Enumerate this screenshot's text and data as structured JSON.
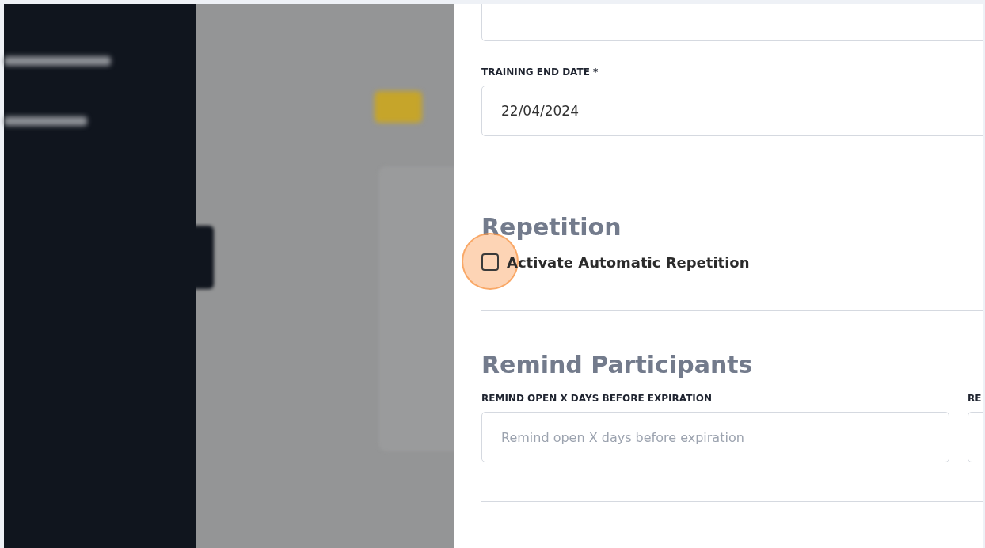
{
  "end_date": {
    "label": "TRAINING END DATE *",
    "value": "22/04/2024"
  },
  "repetition": {
    "title": "Repetition",
    "checkbox": {
      "label": "Activate Automatic Repetition",
      "checked": false,
      "highlighted": true
    }
  },
  "remind": {
    "title": "Remind Participants",
    "fields": [
      {
        "label": "REMIND OPEN X DAYS BEFORE EXPIRATION",
        "placeholder": "Remind open X days before expiration"
      },
      {
        "label": "RE"
      }
    ]
  }
}
